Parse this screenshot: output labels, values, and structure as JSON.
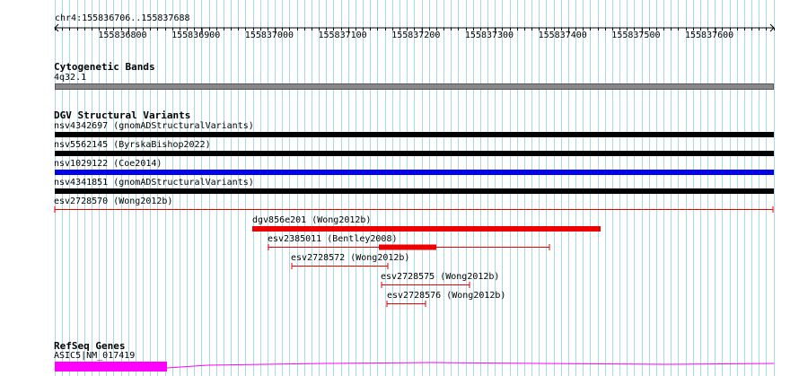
{
  "ruler": {
    "location": "chr4:155836706..155837688",
    "ticks": [
      "155836800",
      "155836900",
      "155837000",
      "155837100",
      "155837200",
      "155837300",
      "155837400",
      "155837500",
      "155837600"
    ]
  },
  "tracks": {
    "cytoband": {
      "name": "Cytogenetic Bands",
      "band": "4q32.1"
    },
    "dgv": {
      "name": "DGV Structural Variants",
      "features": [
        {
          "label": "nsv4342697 (gnomADStructuralVariants)",
          "color": "#000000"
        },
        {
          "label": "nsv5562145 (ByrskaBishop2022)",
          "color": "#000000"
        },
        {
          "label": "nsv1029122 (Coe2014)",
          "color": "#0000ee"
        },
        {
          "label": "nsv4341851 (gnomADStructuralVariants)",
          "color": "#000000"
        },
        {
          "label": "esv2728570 (Wong2012b)",
          "color": "#ee0000"
        },
        {
          "label": "dgv856e201 (Wong2012b)",
          "color": "#ee0000"
        },
        {
          "label": "esv2385011 (Bentley2008)",
          "color": "#ee0000"
        },
        {
          "label": "esv2728572 (Wong2012b)",
          "color": "#ee0000"
        },
        {
          "label": "esv2728575 (Wong2012b)",
          "color": "#ee0000"
        },
        {
          "label": "esv2728576 (Wong2012b)",
          "color": "#ee0000"
        }
      ]
    },
    "refseq": {
      "name": "RefSeq Genes",
      "gene": "ASIC5|NM_017419",
      "color": "#ff00ff"
    }
  }
}
